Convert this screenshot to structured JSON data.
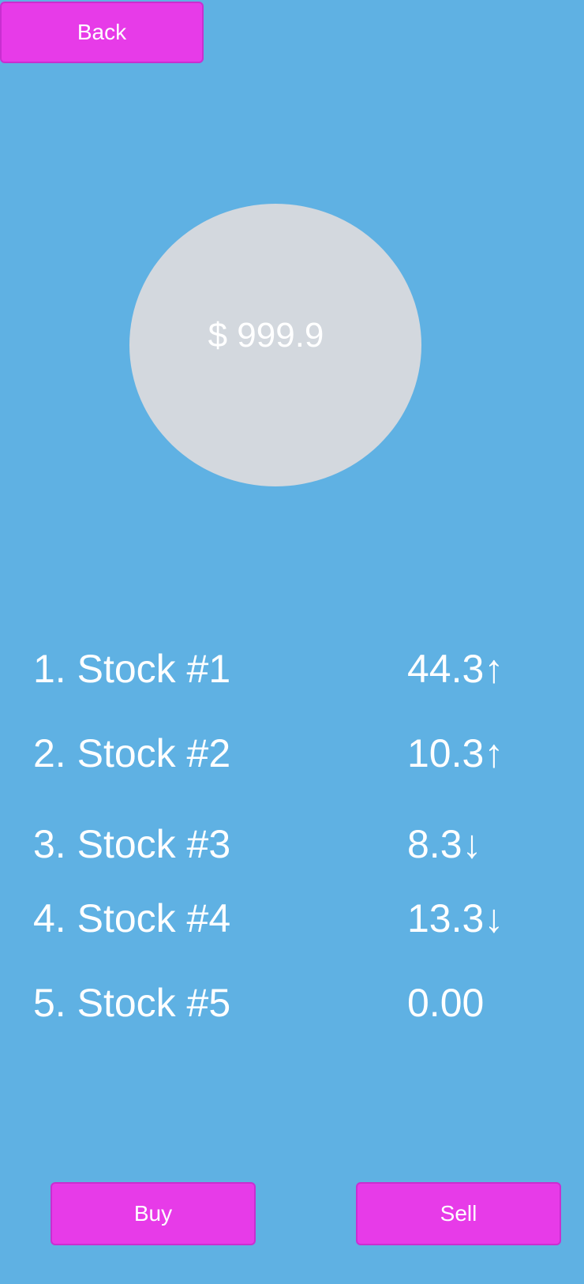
{
  "header": {
    "back_label": "Back"
  },
  "balance": {
    "text": "$ 999.9"
  },
  "stocks": [
    {
      "name": "1. Stock #1",
      "value": "44.3↑"
    },
    {
      "name": "2. Stock #2",
      "value": "10.3↑"
    },
    {
      "name": "3. Stock #3",
      "value": "8.3↓"
    },
    {
      "name": "4. Stock #4",
      "value": "13.3↓"
    },
    {
      "name": "5. Stock #5",
      "value": "0.00"
    }
  ],
  "actions": {
    "buy_label": "Buy",
    "sell_label": "Sell"
  },
  "colors": {
    "background": "#5fb1e3",
    "button": "#e73be8",
    "balance_circle": "#d3d8de",
    "text": "#ffffff"
  }
}
